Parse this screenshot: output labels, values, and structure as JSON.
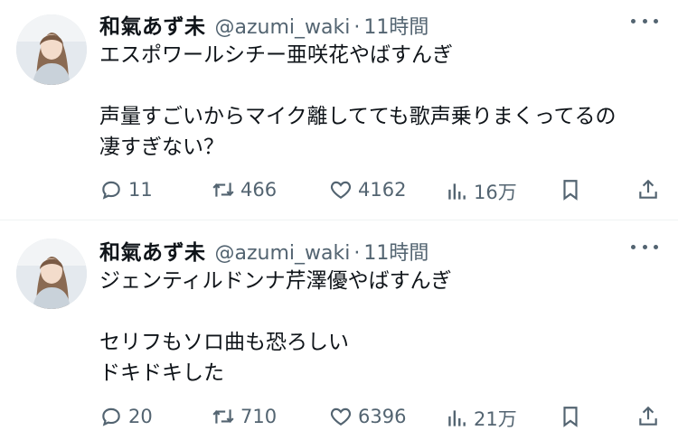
{
  "tweets": [
    {
      "author_name": "和氣あず未",
      "handle": "@azumi_waki",
      "separator": "·",
      "time": "11時間",
      "lines": [
        "エスポワールシチー亜咲花やばすんぎ",
        "",
        "声量すごいからマイク離してても歌声乗りまくってるの",
        "凄すぎない？"
      ],
      "replies": "11",
      "retweets": "466",
      "likes": "4162",
      "views": "16万"
    },
    {
      "author_name": "和氣あず未",
      "handle": "@azumi_waki",
      "separator": "·",
      "time": "11時間",
      "lines": [
        "ジェンティルドンナ芹澤優やばすんぎ",
        "",
        "セリフもソロ曲も恐ろしい",
        "ドキドキした"
      ],
      "replies": "20",
      "retweets": "710",
      "likes": "6396",
      "views": "21万"
    }
  ],
  "icons": {
    "reply": "reply-icon",
    "retweet": "retweet-icon",
    "like": "heart-icon",
    "views": "views-chart-icon",
    "bookmark": "bookmark-icon",
    "share": "share-icon",
    "more": "more-dots-icon"
  },
  "colors": {
    "text": "#0f1419",
    "secondary": "#536471",
    "divider": "#eff3f4"
  }
}
